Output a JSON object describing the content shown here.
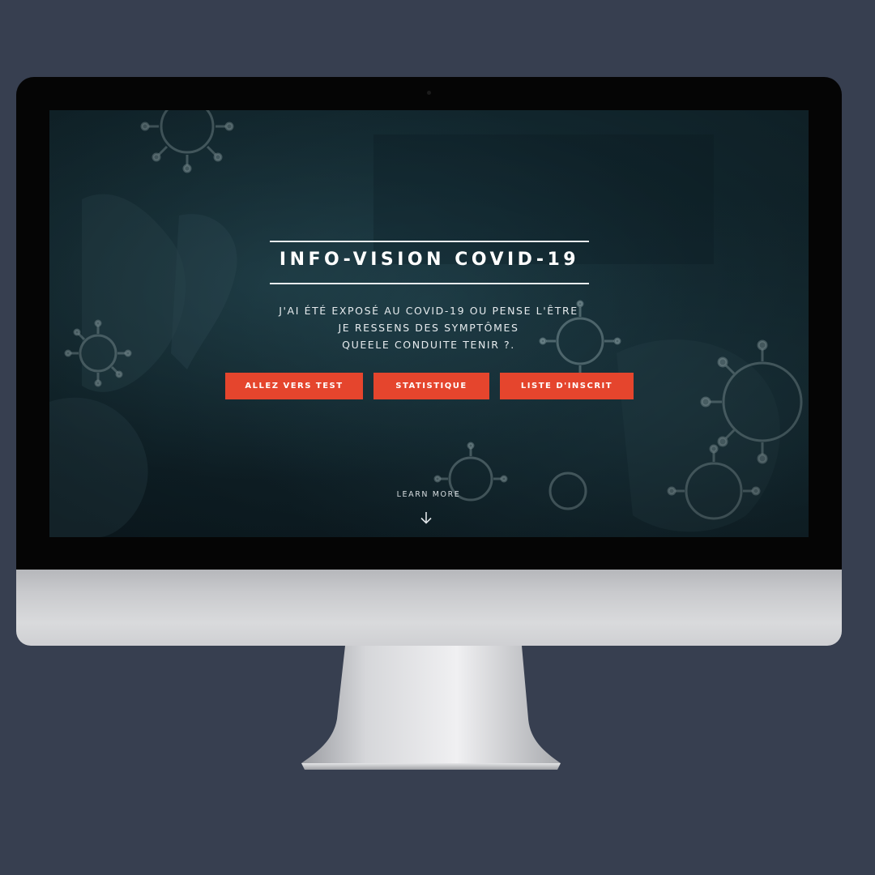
{
  "hero": {
    "title": "INFO-VISION COVID-19",
    "lines": [
      "J'AI ÉTÉ EXPOSÉ AU COVID-19 OU PENSE L'ÊTRE",
      "JE RESSENS DES SYMPTÔMES",
      "QUEELE CONDUITE TENIR ?."
    ],
    "buttons": [
      {
        "label": "ALLEZ VERS TEST"
      },
      {
        "label": "STATISTIQUE"
      },
      {
        "label": "LISTE D'INSCRIT"
      }
    ],
    "learn_more": "LEARN MORE"
  },
  "icons": {
    "learn_more_arrow": "arrow-down-icon",
    "camera": "camera-icon"
  },
  "colors": {
    "page_background": "#373f50",
    "button_accent": "#e5452d",
    "screen_background": "#142b33",
    "text_light": "#ffffff"
  }
}
